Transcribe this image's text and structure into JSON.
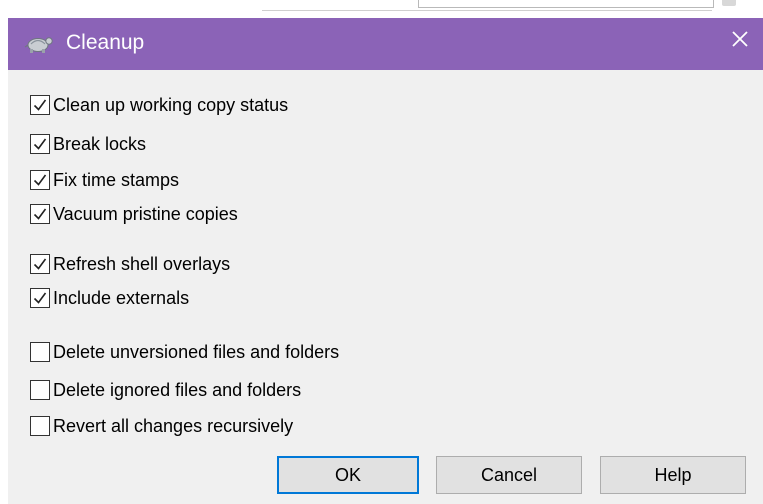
{
  "window": {
    "title": "Cleanup",
    "title_icon": "tortoise-icon",
    "close_glyph": "✕",
    "titlebar_color": "#8b63b7",
    "body_color": "#f0f0f0"
  },
  "options": [
    {
      "label": "Clean up working copy status",
      "checked": true
    },
    {
      "label": "Break locks",
      "checked": true
    },
    {
      "label": "Fix time stamps",
      "checked": true
    },
    {
      "label": "Vacuum pristine copies",
      "checked": true
    },
    {
      "label": "Refresh shell overlays",
      "checked": true
    },
    {
      "label": "Include externals",
      "checked": true
    },
    {
      "label": "Delete unversioned files and folders",
      "checked": false
    },
    {
      "label": "Delete ignored files and folders",
      "checked": false
    },
    {
      "label": "Revert all changes recursively",
      "checked": false
    }
  ],
  "buttons": {
    "ok": "OK",
    "cancel": "Cancel",
    "help": "Help",
    "default_border_color": "#0078d7"
  }
}
